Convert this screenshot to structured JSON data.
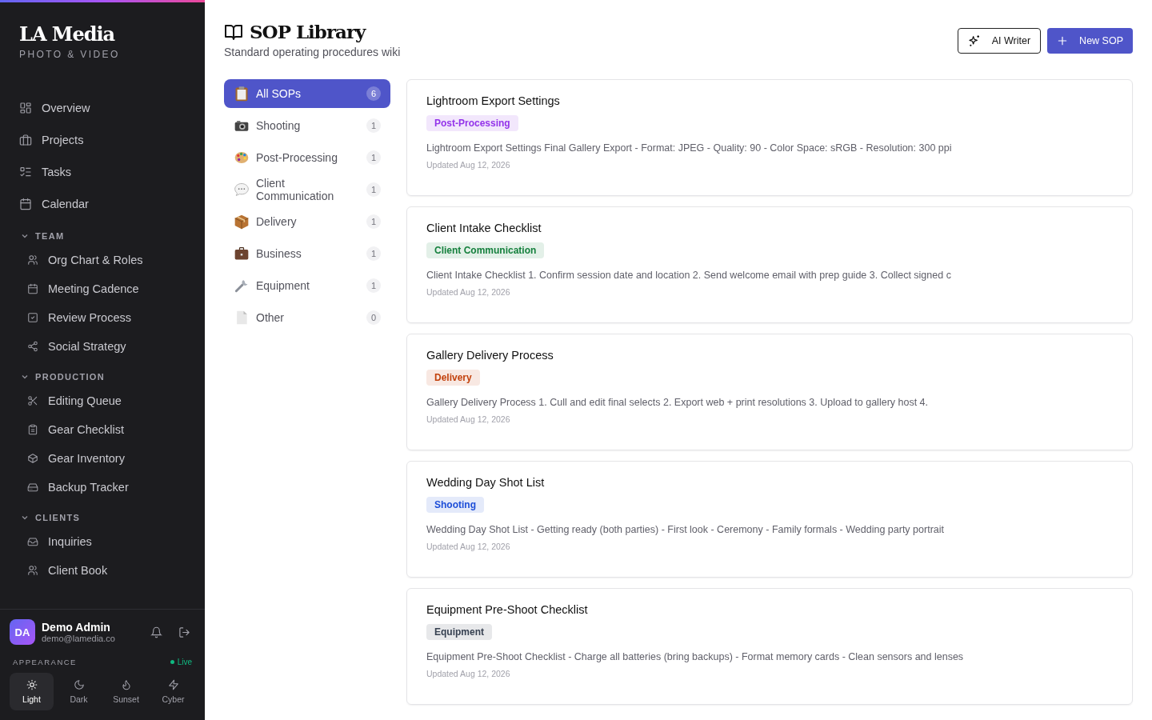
{
  "brand": {
    "name": "LA Media",
    "tagline": "PHOTO & VIDEO"
  },
  "nav": [
    {
      "label": "Overview",
      "kind": "grid"
    },
    {
      "label": "Projects",
      "kind": "briefcase"
    },
    {
      "label": "Tasks",
      "kind": "list"
    },
    {
      "label": "Calendar",
      "kind": "calendar"
    }
  ],
  "sections": [
    {
      "title": "TEAM",
      "expanded": true,
      "items": [
        {
          "label": "Org Chart & Roles",
          "kind": "users"
        },
        {
          "label": "Meeting Cadence",
          "kind": "calendar"
        },
        {
          "label": "Review Process",
          "kind": "check"
        },
        {
          "label": "Social Strategy",
          "kind": "share"
        }
      ]
    },
    {
      "title": "PRODUCTION",
      "expanded": true,
      "items": [
        {
          "label": "Editing Queue",
          "kind": "scissors"
        },
        {
          "label": "Gear Checklist",
          "kind": "clipboard"
        },
        {
          "label": "Gear Inventory",
          "kind": "cube"
        },
        {
          "label": "Backup Tracker",
          "kind": "drive"
        }
      ]
    },
    {
      "title": "CLIENTS",
      "expanded": true,
      "items": [
        {
          "label": "Inquiries",
          "kind": "inbox"
        },
        {
          "label": "Client Book",
          "kind": "users"
        }
      ]
    }
  ],
  "user": {
    "initials": "DA",
    "name": "Demo Admin",
    "email": "demo@lamedia.co"
  },
  "appearance": {
    "label": "APPEARANCE",
    "status": "Live",
    "themes": [
      {
        "label": "Light",
        "kind": "sun",
        "selected": true
      },
      {
        "label": "Dark",
        "kind": "moon",
        "selected": false
      },
      {
        "label": "Sunset",
        "kind": "flame",
        "selected": false
      },
      {
        "label": "Cyber",
        "kind": "bolt",
        "selected": false
      }
    ]
  },
  "page": {
    "title": "SOP Library",
    "subtitle": "Standard operating procedures wiki"
  },
  "buttons": {
    "ai_writer": "AI Writer",
    "new_sop": "New SOP"
  },
  "categories": [
    {
      "label": "All SOPs",
      "count": "6",
      "kind": "clipboard",
      "selected": true
    },
    {
      "label": "Shooting",
      "count": "1",
      "kind": "camera",
      "selected": false
    },
    {
      "label": "Post-Processing",
      "count": "1",
      "kind": "palette",
      "selected": false
    },
    {
      "label": "Client Communication",
      "count": "1",
      "kind": "speech",
      "selected": false
    },
    {
      "label": "Delivery",
      "count": "1",
      "kind": "package",
      "selected": false
    },
    {
      "label": "Business",
      "count": "1",
      "kind": "briefcase",
      "selected": false
    },
    {
      "label": "Equipment",
      "count": "1",
      "kind": "wrench",
      "selected": false
    },
    {
      "label": "Other",
      "count": "0",
      "kind": "page",
      "selected": false
    }
  ],
  "sops": [
    {
      "title": "Lightroom Export Settings",
      "tag": "Post-Processing",
      "color": "#9333ea",
      "excerpt": "Lightroom Export Settings Final Gallery Export - Format: JPEG - Quality: 90 - Color Space: sRGB - Resolution: 300 ppi",
      "updated": "Updated Aug 12, 2026"
    },
    {
      "title": "Client Intake Checklist",
      "tag": "Client Communication",
      "color": "#15803d",
      "excerpt": "Client Intake Checklist 1. Confirm session date and location 2. Send welcome email with prep guide 3. Collect signed c",
      "updated": "Updated Aug 12, 2026"
    },
    {
      "title": "Gallery Delivery Process",
      "tag": "Delivery",
      "color": "#c2410c",
      "excerpt": "Gallery Delivery Process 1. Cull and edit final selects 2. Export web + print resolutions 3. Upload to gallery host 4.",
      "updated": "Updated Aug 12, 2026"
    },
    {
      "title": "Wedding Day Shot List",
      "tag": "Shooting",
      "color": "#1d4ed8",
      "excerpt": "Wedding Day Shot List - Getting ready (both parties) - First look - Ceremony - Family formals - Wedding party portrait",
      "updated": "Updated Aug 12, 2026"
    },
    {
      "title": "Equipment Pre-Shoot Checklist",
      "tag": "Equipment",
      "color": "#374151",
      "excerpt": "Equipment Pre-Shoot Checklist - Charge all batteries (bring backups) - Format memory cards - Clean sensors and lenses",
      "updated": "Updated Aug 12, 2026"
    }
  ]
}
